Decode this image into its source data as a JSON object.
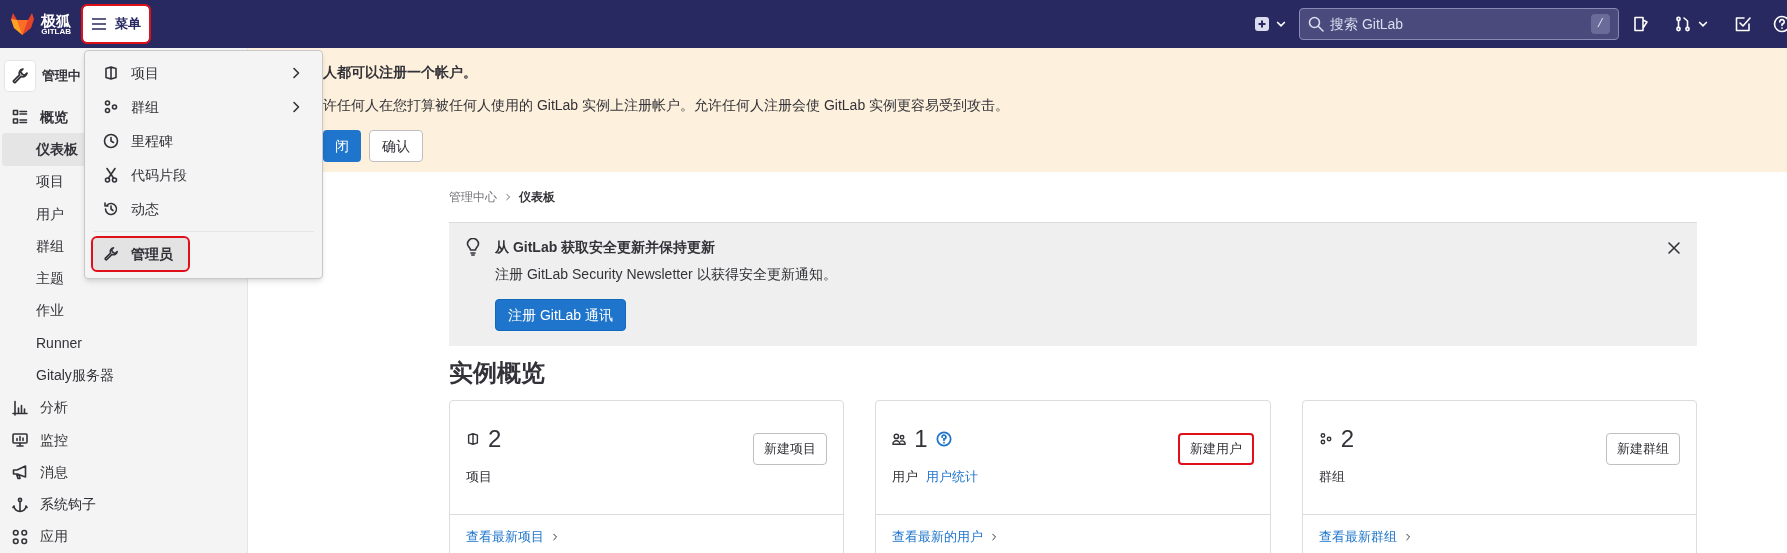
{
  "header": {
    "logo_text": "极狐",
    "logo_subtext": "GITLAB",
    "menu_button": {
      "label": "菜单",
      "highlighted": true
    },
    "search": {
      "placeholder": "搜索 GitLab",
      "shortcut": "/"
    }
  },
  "menu_dropdown": {
    "items": [
      {
        "label": "项目",
        "has_submenu": true,
        "selected": false,
        "highlighted": false
      },
      {
        "label": "群组",
        "has_submenu": true,
        "selected": false,
        "highlighted": false
      },
      {
        "label": "里程碑",
        "has_submenu": false,
        "selected": false,
        "highlighted": false
      },
      {
        "label": "代码片段",
        "has_submenu": false,
        "selected": false,
        "highlighted": false
      },
      {
        "label": "动态",
        "has_submenu": false,
        "selected": false,
        "highlighted": false
      },
      {
        "label": "管理员",
        "has_submenu": false,
        "selected": true,
        "highlighted": true
      }
    ]
  },
  "sidebar": {
    "title": "管理中",
    "items": [
      {
        "label": "概览",
        "selected": false,
        "children": [
          {
            "label": "仪表板",
            "selected": true
          },
          {
            "label": "项目",
            "selected": false
          },
          {
            "label": "用户",
            "selected": false
          },
          {
            "label": "群组",
            "selected": false
          },
          {
            "label": "主题",
            "selected": false
          },
          {
            "label": "作业",
            "selected": false
          },
          {
            "label": "Runner",
            "selected": false
          },
          {
            "label": "Gitaly服务器",
            "selected": false
          }
        ]
      },
      {
        "label": "分析",
        "selected": false
      },
      {
        "label": "监控",
        "selected": false
      },
      {
        "label": "消息",
        "selected": false
      },
      {
        "label": "系统钩子",
        "selected": false
      },
      {
        "label": "应用",
        "selected": false
      }
    ]
  },
  "banner": {
    "title": "人都可以注册一个帐户。",
    "text": "许任何人在您打算被任何人使用的 GitLab 实例上注册帐户。允许任何人注册会使 GitLab 实例更容易受到攻击。",
    "buttons": [
      {
        "label": "闭",
        "kind": "primary"
      },
      {
        "label": "确认",
        "kind": "secondary"
      }
    ]
  },
  "breadcrumb": [
    {
      "label": "管理中心"
    },
    {
      "label": "仪表板"
    }
  ],
  "alert": {
    "title": "从 GitLab 获取安全更新并保持更新",
    "text": "注册 GitLab Security Newsletter 以获得安全更新通知。",
    "button": "注册 GitLab 通讯"
  },
  "section_title": "实例概览",
  "cards": [
    {
      "count": "2",
      "label": "项目",
      "help": false,
      "button": {
        "label": "新建项目",
        "highlighted": false
      },
      "footer_link": "查看最新项目"
    },
    {
      "count": "1",
      "label": "用户",
      "link": "用户统计",
      "help": true,
      "button": {
        "label": "新建用户",
        "highlighted": true
      },
      "footer_link": "查看最新的用户"
    },
    {
      "count": "2",
      "label": "群组",
      "help": false,
      "button": {
        "label": "新建群组",
        "highlighted": false
      },
      "footer_link": "查看最新群组"
    }
  ]
}
